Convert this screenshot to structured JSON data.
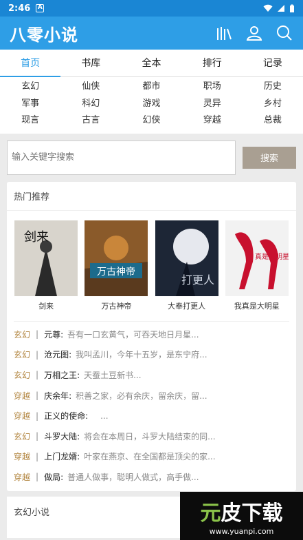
{
  "status": {
    "time": "2:46",
    "a_icon": "A"
  },
  "app": {
    "title": "八零小说"
  },
  "tabs": [
    {
      "label": "首页"
    },
    {
      "label": "书库"
    },
    {
      "label": "全本"
    },
    {
      "label": "排行"
    },
    {
      "label": "记录"
    }
  ],
  "categories": [
    [
      "玄幻",
      "仙侠",
      "都市",
      "职场",
      "历史"
    ],
    [
      "军事",
      "科幻",
      "游戏",
      "灵异",
      "乡村"
    ],
    [
      "现言",
      "古言",
      "幻侠",
      "穿越",
      "总裁"
    ]
  ],
  "search": {
    "placeholder": "输入关键字搜索",
    "button": "搜索"
  },
  "hot": {
    "title": "热门推荐",
    "books": [
      {
        "title": "剑来",
        "cover_text": "剑来"
      },
      {
        "title": "万古神帝",
        "cover_text": "万古神帝"
      },
      {
        "title": "大奉打更人",
        "cover_text": "打更人"
      },
      {
        "title": "我真是大明星",
        "cover_text": "真是大明星"
      }
    ],
    "list": [
      {
        "tag": "玄幻",
        "sep": "|",
        "name": "元尊:",
        "desc": "吾有一口玄黄气，可吞天地日月星..."
      },
      {
        "tag": "玄幻",
        "sep": "|",
        "name": "沧元图:",
        "desc": "我叫孟川，今年十五岁，是东宁府..."
      },
      {
        "tag": "玄幻",
        "sep": "|",
        "name": "万相之王:",
        "desc": "天蚕土豆新书..."
      },
      {
        "tag": "穿越",
        "sep": "|",
        "name": "庆余年:",
        "desc": "积善之家，必有余庆，留余庆，留..."
      },
      {
        "tag": "穿越",
        "sep": "|",
        "name": "正义的使命:",
        "desc": "..."
      },
      {
        "tag": "玄幻",
        "sep": "|",
        "name": "斗罗大陆:",
        "desc": "将会在本周日，斗罗大陆结束的同..."
      },
      {
        "tag": "穿越",
        "sep": "|",
        "name": "上门龙婿:",
        "desc": "叶家在燕京、在全国都是顶尖的家..."
      },
      {
        "tag": "穿越",
        "sep": "|",
        "name": "做局:",
        "desc": "普通人做事，聪明人做式，高手做..."
      }
    ]
  },
  "section2": {
    "title": "玄幻小说"
  },
  "watermark": {
    "text_a": "元",
    "text_b": "皮下载",
    "url": "www.yuanpi.com"
  },
  "colors": {
    "statusbar": "#1a86d4",
    "appbar": "#2e9ee6",
    "accent": "#2e9ee6",
    "tag": "#b2853f",
    "search_button": "#a99f92"
  }
}
